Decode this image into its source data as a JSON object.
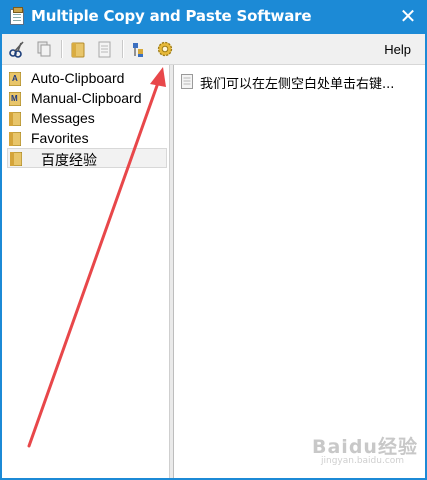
{
  "window": {
    "title": "Multiple Copy and Paste Software",
    "close_glyph": "✕"
  },
  "toolbar": {
    "icons": [
      "cut-icon",
      "copy-icon",
      "new-folder-icon",
      "new-note-icon",
      "tree-icon",
      "settings-gear-icon"
    ],
    "help_label": "Help"
  },
  "tree": {
    "items": [
      {
        "label": "Auto-Clipboard",
        "icon": "auto-clipboard-folder-icon"
      },
      {
        "label": "Manual-Clipboard",
        "icon": "manual-clipboard-folder-icon"
      },
      {
        "label": "Messages",
        "icon": "folder-icon"
      },
      {
        "label": "Favorites",
        "icon": "folder-icon"
      },
      {
        "label": "百度经验",
        "icon": "folder-icon",
        "selected": true
      }
    ]
  },
  "notes": {
    "items": [
      {
        "text": "我们可以在左侧空白处单击右键..."
      }
    ]
  },
  "watermark": {
    "text": "Baidu经验",
    "sub": "jingyan.baidu.com"
  },
  "colors": {
    "titlebar": "#1c8ad6",
    "annotation_arrow": "#e8474a"
  }
}
